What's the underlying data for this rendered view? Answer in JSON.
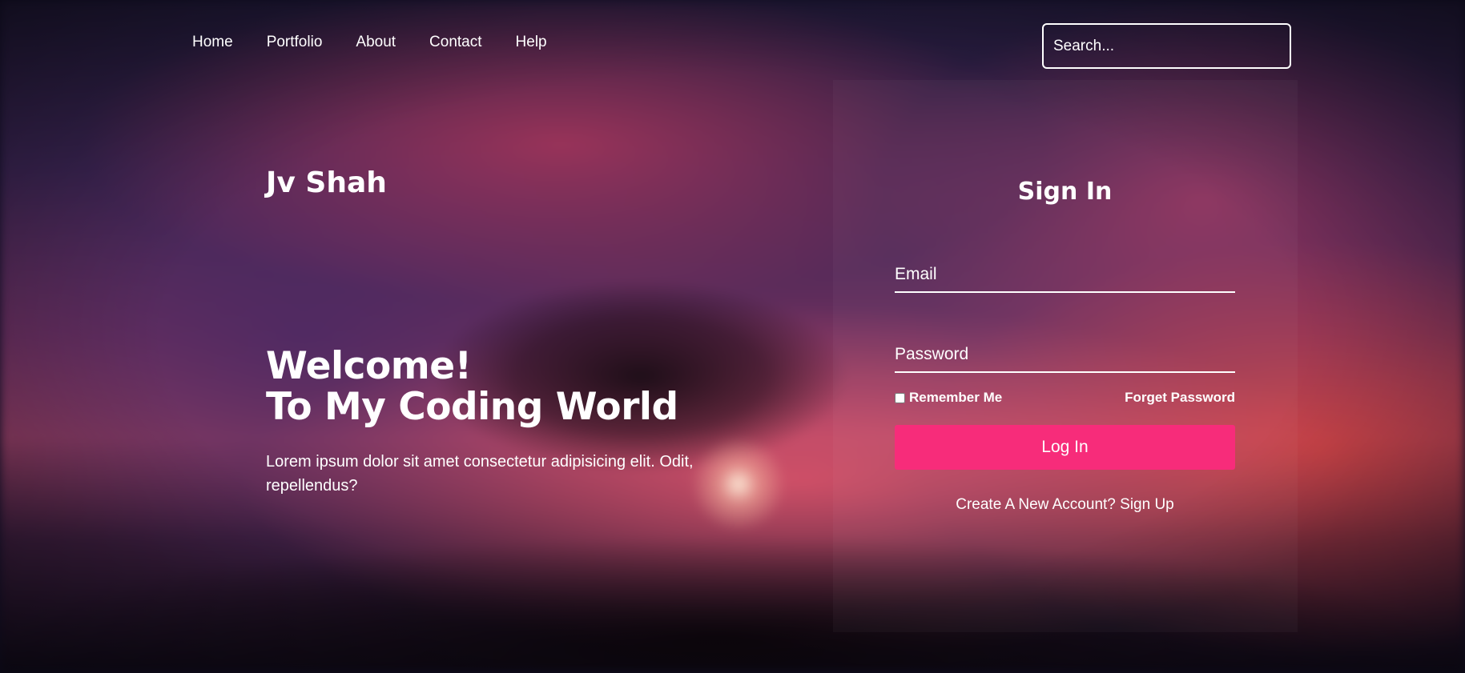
{
  "nav": {
    "items": [
      {
        "label": "Home"
      },
      {
        "label": "Portfolio"
      },
      {
        "label": "About"
      },
      {
        "label": "Contact"
      },
      {
        "label": "Help"
      }
    ]
  },
  "search": {
    "placeholder": "Search..."
  },
  "hero": {
    "brand": "Jv Shah",
    "welcome_line1": "Welcome!",
    "welcome_line2": "To My Coding World",
    "body": "Lorem ipsum dolor sit amet consectetur adipisicing elit. Odit, repellendus?"
  },
  "signin": {
    "title": "Sign In",
    "email_placeholder": "Email",
    "password_placeholder": "Password",
    "remember_label": "Remember Me",
    "forget_label": "Forget Password",
    "login_label": "Log In",
    "signup_prefix": "Create A New Account? ",
    "signup_link": "Sign Up"
  },
  "colors": {
    "accent": "#f72c7a"
  }
}
